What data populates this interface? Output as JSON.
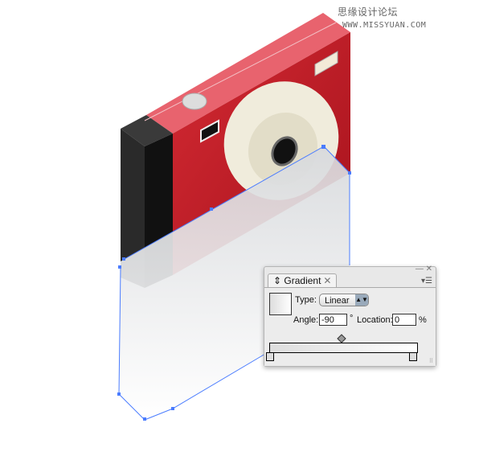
{
  "watermark": {
    "text": "思缘设计论坛",
    "url": "WWW.MISSYUAN.COM"
  },
  "panel": {
    "tab_label": "Gradient",
    "type_label": "Type:",
    "type_value": "Linear",
    "angle_label": "Angle:",
    "angle_value": "-90",
    "angle_unit": "°",
    "location_label": "Location:",
    "location_value": "0",
    "location_unit": "%"
  },
  "colors": {
    "camera_red": "#c8202b",
    "path_blue": "#4a7cff"
  }
}
